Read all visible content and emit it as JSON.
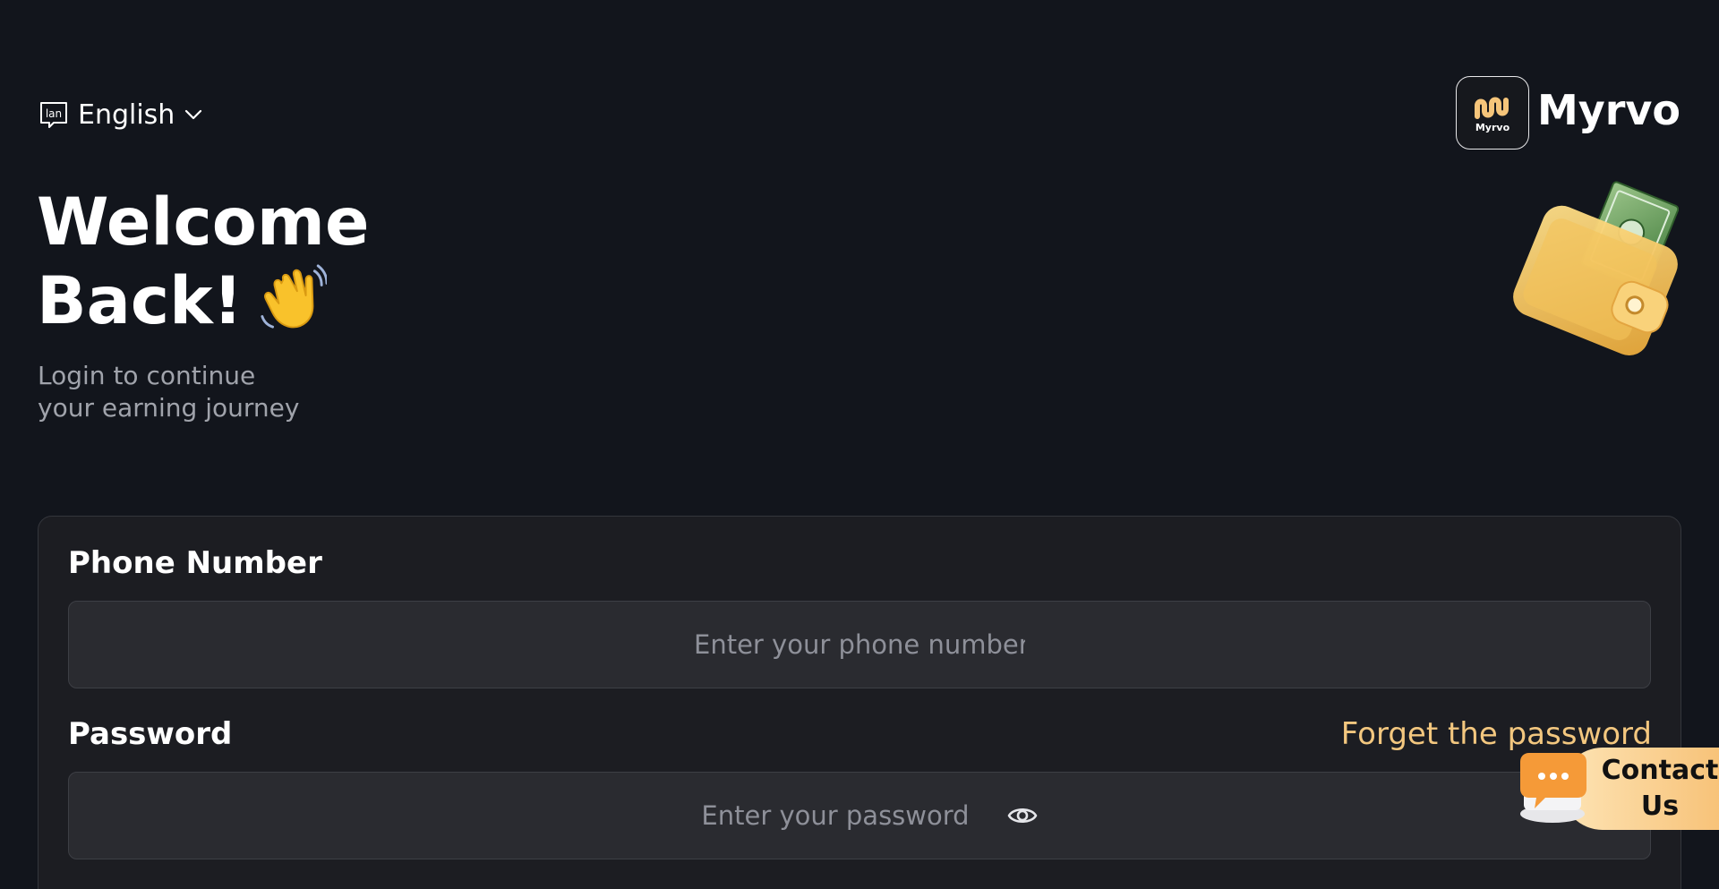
{
  "language": {
    "label": "English",
    "icon": "language-icon",
    "icon_text": "lan"
  },
  "brand": {
    "name": "Myrvo",
    "logo_text": "Myrvo",
    "accent": "#f6c57a"
  },
  "hero": {
    "title_line1": "Welcome",
    "title_line2": "Back!",
    "title_emoji": "waving-hand-icon",
    "subtitle_line1": "Login to continue",
    "subtitle_line2": "your earning journey",
    "illustration": "wallet-with-cash-icon"
  },
  "form": {
    "phone_label": "Phone Number",
    "phone_placeholder": "Enter your phone number",
    "password_label": "Password",
    "password_placeholder": "Enter your password",
    "forget_label": "Forget the password"
  },
  "contact": {
    "label_line1": "Contact",
    "label_line2": "Us",
    "icon": "chat-bubble-icon"
  },
  "colors": {
    "background": "#12151c",
    "card": "#1c1d22",
    "field": "#2a2b30",
    "link": "#f3c77f",
    "subtitle": "#a0a3ab"
  }
}
